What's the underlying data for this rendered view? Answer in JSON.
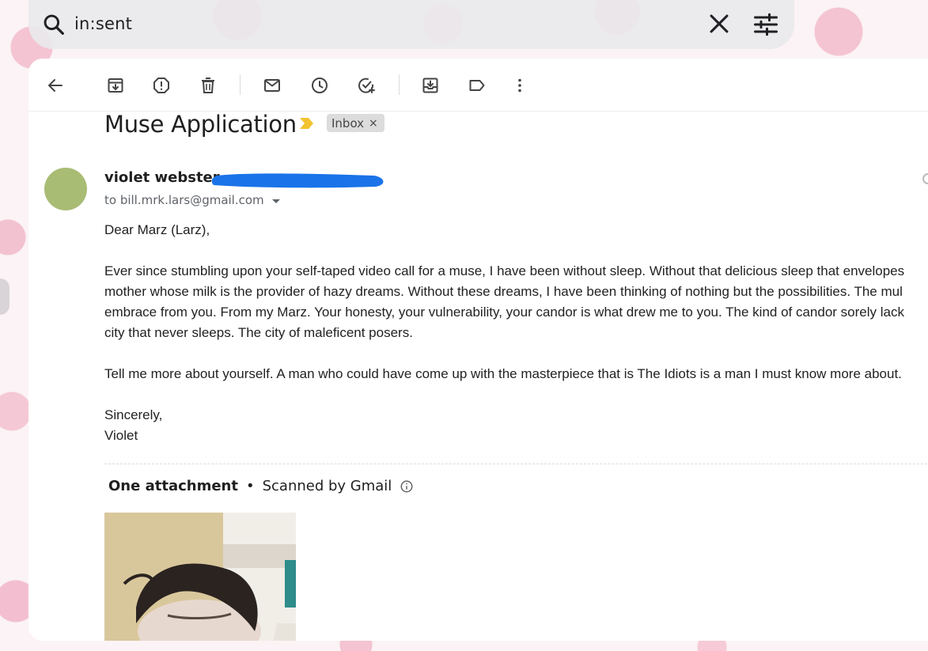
{
  "search": {
    "query": "in:sent"
  },
  "icons": {
    "search": "search-icon",
    "clear": "close-icon",
    "options": "tune-icon",
    "back": "arrow-back-icon",
    "archive": "archive-icon",
    "spam": "report-spam-icon",
    "delete": "delete-icon",
    "mark_unread": "mail-icon",
    "snooze": "clock-icon",
    "add_task": "add-task-icon",
    "move_to": "move-to-inbox-icon",
    "labels": "label-icon",
    "more": "more-vert-icon",
    "importance": "importance-marker-icon",
    "info": "info-icon"
  },
  "email": {
    "subject": "Muse Application",
    "label_chip": "Inbox",
    "label_chip_remove": "×",
    "sender_name": "violet webster",
    "recipient": "to bill.mrk.lars@gmail.com",
    "body": {
      "greeting": "Dear Marz (Larz),",
      "para1": [
        "Ever since stumbling upon your self-taped video call for a muse, I have been without sleep. Without that delicious sleep that envelopes",
        "mother whose milk is the provider of hazy dreams. Without these dreams, I have been thinking of nothing but the possibilities. The mul",
        "embrace from you. From my Marz. Your honesty, your vulnerability, your candor is what drew me to you. The kind of candor sorely lack",
        "city that never sleeps. The city of maleficent posers."
      ],
      "para2": "Tell me more about yourself. A man who could have come up with the masterpiece that is The Idiots is a man I must know more about.",
      "closing": "Sincerely,",
      "signature": "Violet"
    },
    "attachments": {
      "title": "One attachment",
      "separator": "•",
      "scan_note": "Scanned by Gmail"
    }
  },
  "colors": {
    "avatar": "#a8bc74",
    "importance_marker": "#f2c230",
    "redaction": "#1a73e8"
  }
}
